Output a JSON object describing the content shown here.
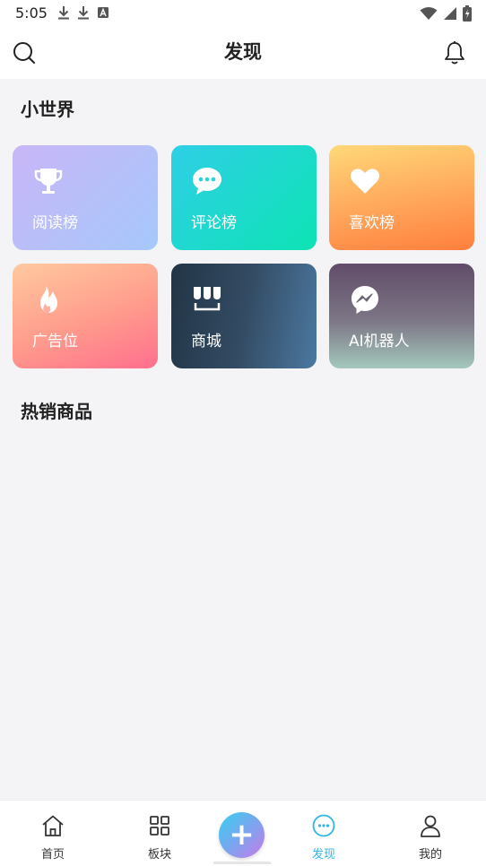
{
  "status_bar": {
    "time": "5:05",
    "left_icons": [
      "download-icon",
      "download-icon",
      "a-box-icon"
    ],
    "right_icons": [
      "wifi-icon",
      "signal-icon",
      "battery-icon"
    ]
  },
  "header": {
    "title": "发现",
    "left_icon": "search-icon",
    "right_icon": "bell-icon"
  },
  "sections": {
    "small_world": {
      "title": "小世界"
    },
    "hot_products": {
      "title": "热销商品"
    }
  },
  "cards": [
    {
      "label": "阅读榜",
      "icon": "trophy-icon",
      "colors": [
        "#c9b6f7",
        "#a6c8fb"
      ]
    },
    {
      "label": "评论榜",
      "icon": "chat-bubble-icon",
      "colors": [
        "#2fcfe6",
        "#0de3b4"
      ]
    },
    {
      "label": "喜欢榜",
      "icon": "heart-icon",
      "colors": [
        "#ffd879",
        "#ff7f3e"
      ]
    },
    {
      "label": "广告位",
      "icon": "flame-icon",
      "colors": [
        "#ffc99f",
        "#ff6f8e"
      ]
    },
    {
      "label": "商城",
      "icon": "shop-icon",
      "colors": [
        "#223546",
        "#4b78a0"
      ]
    },
    {
      "label": "AI机器人",
      "icon": "messenger-icon",
      "colors": [
        "#614c69",
        "#a4c8bd"
      ]
    }
  ],
  "bottom_nav": {
    "items": [
      {
        "label": "首页",
        "icon": "home-icon"
      },
      {
        "label": "板块",
        "icon": "grid-icon"
      },
      {
        "label": "发现",
        "icon": "discover-chat-icon",
        "active": true
      },
      {
        "label": "我的",
        "icon": "user-icon"
      }
    ],
    "fab_icon": "plus-icon",
    "active_color": "#2fb6e6"
  }
}
